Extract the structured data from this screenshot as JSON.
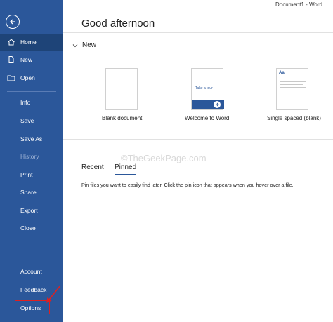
{
  "window": {
    "title": "Document1 - Word"
  },
  "sidebar": {
    "items": [
      {
        "label": "Home"
      },
      {
        "label": "New"
      },
      {
        "label": "Open"
      },
      {
        "label": "Info"
      },
      {
        "label": "Save"
      },
      {
        "label": "Save As"
      },
      {
        "label": "History"
      },
      {
        "label": "Print"
      },
      {
        "label": "Share"
      },
      {
        "label": "Export"
      },
      {
        "label": "Close"
      },
      {
        "label": "Account"
      },
      {
        "label": "Feedback"
      },
      {
        "label": "Options"
      }
    ]
  },
  "main": {
    "greeting": "Good afternoon",
    "new_section": "New",
    "templates": [
      {
        "caption": "Blank document"
      },
      {
        "caption": "Welcome to Word",
        "thumb_text": "Take a tour"
      },
      {
        "caption": "Single spaced (blank)",
        "thumb_text": "Aa"
      }
    ],
    "tabs": [
      {
        "label": "Recent"
      },
      {
        "label": "Pinned"
      }
    ],
    "pinned_message": "Pin files you want to easily find later. Click the pin icon that appears when you hover over a file."
  },
  "watermark": "©TheGeekPage.com",
  "colors": {
    "sidebar": "#2b579a",
    "sidebar_active": "#1e4478",
    "highlight": "#e02020"
  }
}
